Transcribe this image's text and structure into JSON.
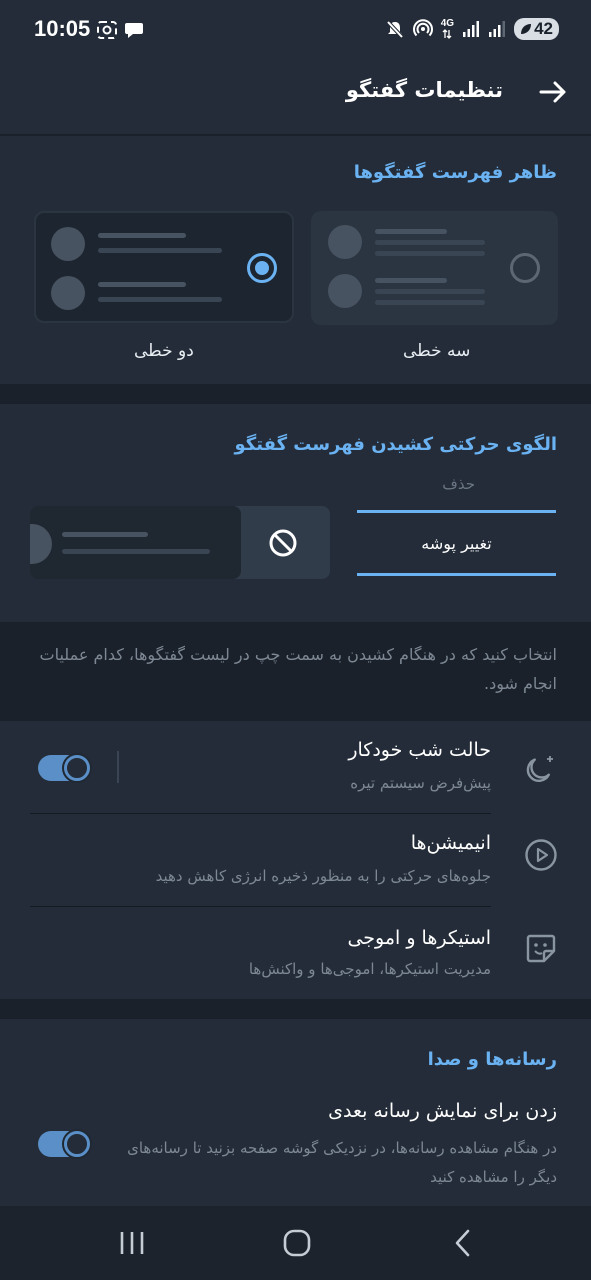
{
  "status_bar": {
    "time": "10:05",
    "network_top": "4G",
    "battery_level": "42",
    "icons": [
      "screenshot-icon",
      "chat-bubble-icon",
      "mute-icon",
      "hotspot-icon",
      "signal-icon",
      "signal-icon",
      "battery-icon"
    ]
  },
  "header": {
    "title": "تنظیمات گفتگو",
    "back_icon": "arrow-right-icon"
  },
  "chat_list_view": {
    "title": "ظاهر فهرست گفتگوها",
    "options": [
      {
        "label": "دو خطی",
        "selected": true
      },
      {
        "label": "سه خطی",
        "selected": false
      }
    ]
  },
  "swipe_gesture": {
    "title": "الگوی حرکتی کشیدن فهرست گفتگو",
    "action_label": "حذف",
    "action_icon": "block-icon",
    "selected_option": "تغییر پوشه",
    "description": "انتخاب کنید که در هنگام کشیدن به سمت چپ در لیست گفتگوها، کدام عملیات انجام شود."
  },
  "settings_rows": [
    {
      "title": "حالت شب خودکار",
      "subtitle": "پیش‌فرض سیستم تیره",
      "icon": "moon-icon",
      "toggle_on": true
    },
    {
      "title": "انیمیشن‌ها",
      "subtitle": "جلوه‌های حرکتی را به منظور ذخیره انرژی کاهش دهید",
      "icon": "play-circle-icon"
    },
    {
      "title": "استیکرها و اموجی",
      "subtitle": "مدیریت استیکرها، اموجی‌ها و واکنش‌ها",
      "icon": "sticker-icon"
    }
  ],
  "media_section": {
    "title": "رسانه‌ها و صدا",
    "tap_next": {
      "title": "زدن برای نمایش رسانه بعدی",
      "subtitle": "در هنگام مشاهده رسانه‌ها، در نزدیکی گوشه صفحه بزنید تا رسانه‌های دیگر را مشاهده کنید",
      "toggle_on": true
    }
  },
  "nav_bar": {
    "buttons": [
      "recents-icon",
      "home-icon",
      "back-icon"
    ]
  },
  "colors": {
    "accent": "#6ab2f2",
    "toggle": "#5a8fc7",
    "background": "#1a212b",
    "surface": "#232c38"
  }
}
